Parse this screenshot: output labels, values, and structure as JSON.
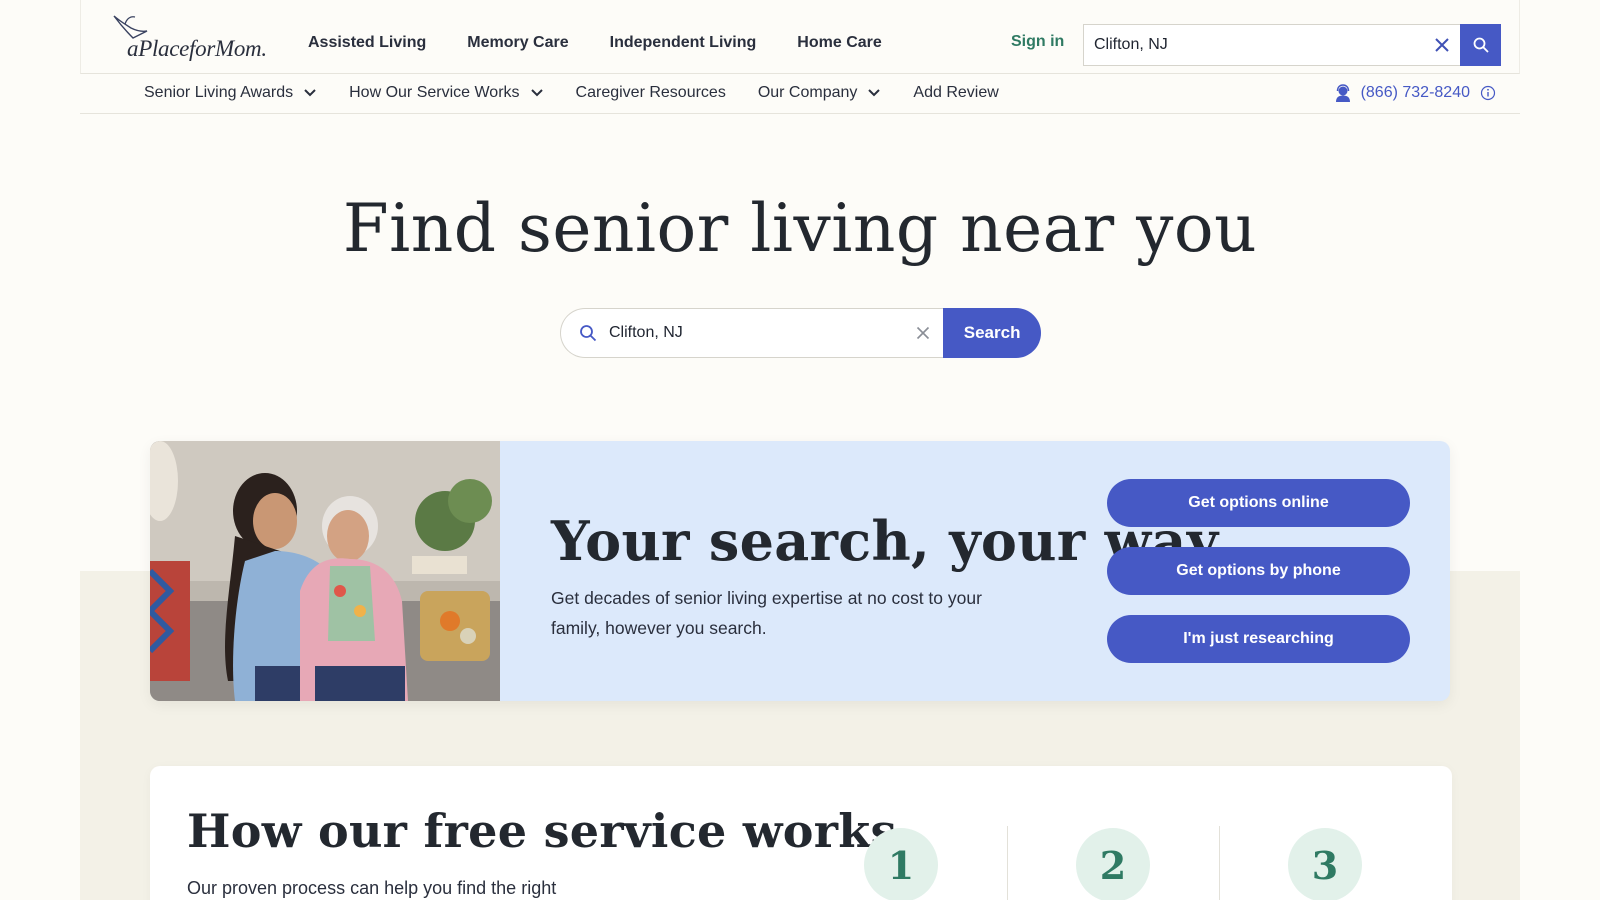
{
  "brand": {
    "logo_text": "aPlaceforMom."
  },
  "header": {
    "nav": [
      "Assisted Living",
      "Memory Care",
      "Independent Living",
      "Home Care"
    ],
    "sign_in": "Sign in",
    "search_value": "Clifton, NJ"
  },
  "subnav": {
    "items": [
      {
        "label": "Senior Living Awards",
        "dropdown": true
      },
      {
        "label": "How Our Service Works",
        "dropdown": true
      },
      {
        "label": "Caregiver Resources",
        "dropdown": false
      },
      {
        "label": "Our Company",
        "dropdown": true
      },
      {
        "label": "Add Review",
        "dropdown": false
      }
    ],
    "phone": "(866) 732-8240"
  },
  "hero": {
    "title": "Find senior living near you",
    "search_value": "Clifton, NJ",
    "search_button": "Search"
  },
  "promo": {
    "title": "Your search, your way",
    "text": "Get decades of senior living expertise at no cost to your family, however you search.",
    "buttons": [
      "Get options online",
      "Get options by phone",
      "I'm just researching"
    ]
  },
  "how": {
    "title": "How our free service works",
    "subtitle": "Our proven process can help you find the right",
    "steps": [
      "1",
      "2",
      "3"
    ]
  },
  "colors": {
    "primary": "#4659c5",
    "accent_green": "#2f7a63",
    "promo_bg": "#dce9fb",
    "page_bg": "#fdfcf8"
  }
}
